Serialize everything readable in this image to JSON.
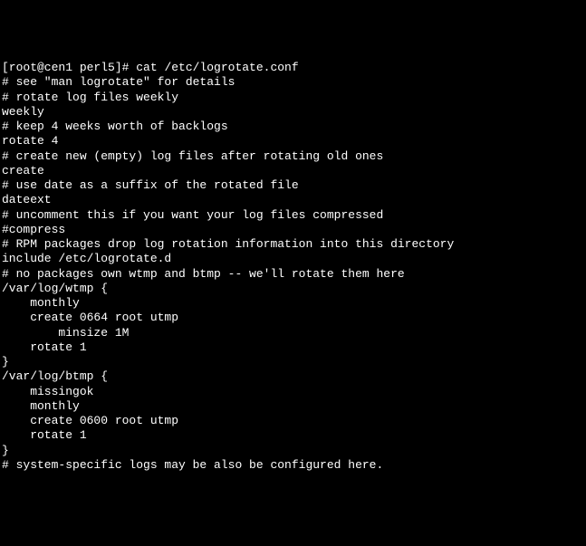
{
  "terminal": {
    "prompt": "[root@cen1 perl5]# ",
    "command": "cat /etc/logrotate.conf",
    "lines": [
      "# see \"man logrotate\" for details",
      "# rotate log files weekly",
      "weekly",
      "",
      "# keep 4 weeks worth of backlogs",
      "rotate 4",
      "",
      "# create new (empty) log files after rotating old ones",
      "create",
      "",
      "# use date as a suffix of the rotated file",
      "dateext",
      "",
      "# uncomment this if you want your log files compressed",
      "#compress",
      "",
      "# RPM packages drop log rotation information into this directory",
      "include /etc/logrotate.d",
      "",
      "# no packages own wtmp and btmp -- we'll rotate them here",
      "/var/log/wtmp {",
      "    monthly",
      "    create 0664 root utmp",
      "        minsize 1M",
      "    rotate 1",
      "}",
      "",
      "/var/log/btmp {",
      "    missingok",
      "    monthly",
      "    create 0600 root utmp",
      "    rotate 1",
      "}",
      "",
      "# system-specific logs may be also be configured here."
    ]
  }
}
